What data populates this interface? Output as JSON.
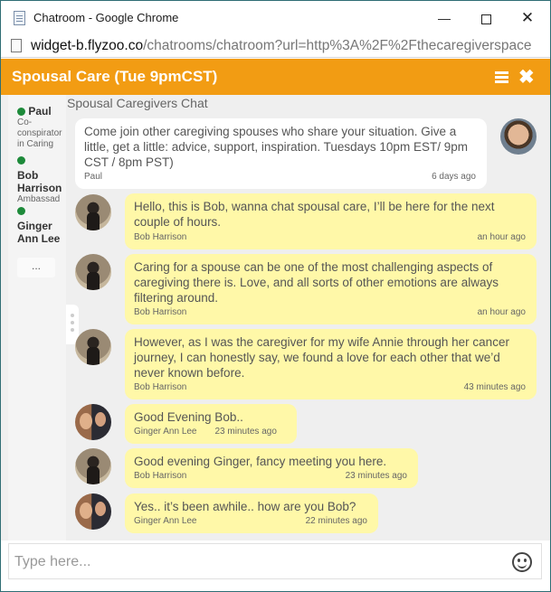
{
  "window": {
    "title": "Chatroom - Google Chrome",
    "url_host": "widget-b.flyzoo.co",
    "url_path": "/chatrooms/chatroom?url=http%3A%2F%2Fthecaregiverspace"
  },
  "header": {
    "room_title": "Spousal Care (Tue 9pmCST)"
  },
  "room": {
    "name": "Spousal Caregivers Chat"
  },
  "members": [
    {
      "name": "Paul",
      "role": "Co-conspirator in Caring",
      "status_color": "#1d8a3a"
    },
    {
      "name": "Bob Harrison",
      "role": "Ambassad",
      "status_color": "#1d8a3a"
    },
    {
      "name": "Ginger Ann Lee",
      "role": "",
      "status_color": "#1d8a3a"
    }
  ],
  "more_label": "...",
  "messages": [
    {
      "author": "Paul",
      "time": "6 days ago",
      "text": "Come join other caregiving spouses who share your situation. Give a little, get a little: advice, support, inspiration. Tuesdays 10pm EST/ 9pm CST / 8pm PST)"
    },
    {
      "author": "Bob Harrison",
      "time": "an hour ago",
      "text": "Hello, this is Bob, wanna chat spousal care, I’ll be here for the next couple of hours."
    },
    {
      "author": "Bob Harrison",
      "time": "an hour ago",
      "text": "Caring for a spouse can be one of the most challenging aspects of caregiving there is. Love, and all sorts of other emotions are always filtering around."
    },
    {
      "author": "Bob Harrison",
      "time": "43 minutes ago",
      "text": "However, as I was the caregiver for my wife Annie through her cancer journey, I can honestly say, we found a love for each other that we’d never known before."
    },
    {
      "author": "Ginger Ann Lee",
      "time": "23 minutes ago",
      "text": "Good Evening Bob.."
    },
    {
      "author": "Bob Harrison",
      "time": "23 minutes ago",
      "text": "Good evening Ginger, fancy meeting you here."
    },
    {
      "author": "Ginger Ann Lee",
      "time": "22 minutes ago",
      "text": "Yes.. it’s been awhile.. how are you Bob?"
    }
  ],
  "composer": {
    "placeholder": "Type here..."
  },
  "colors": {
    "header": "#f29c13",
    "bubble_own": "#fff8a8",
    "bubble_other": "#ffffff",
    "online": "#1d8a3a"
  },
  "icons": [
    "page-icon",
    "minimize-icon",
    "maximize-icon",
    "close-icon",
    "menu-icon",
    "emoji-icon",
    "online-dot-icon"
  ]
}
